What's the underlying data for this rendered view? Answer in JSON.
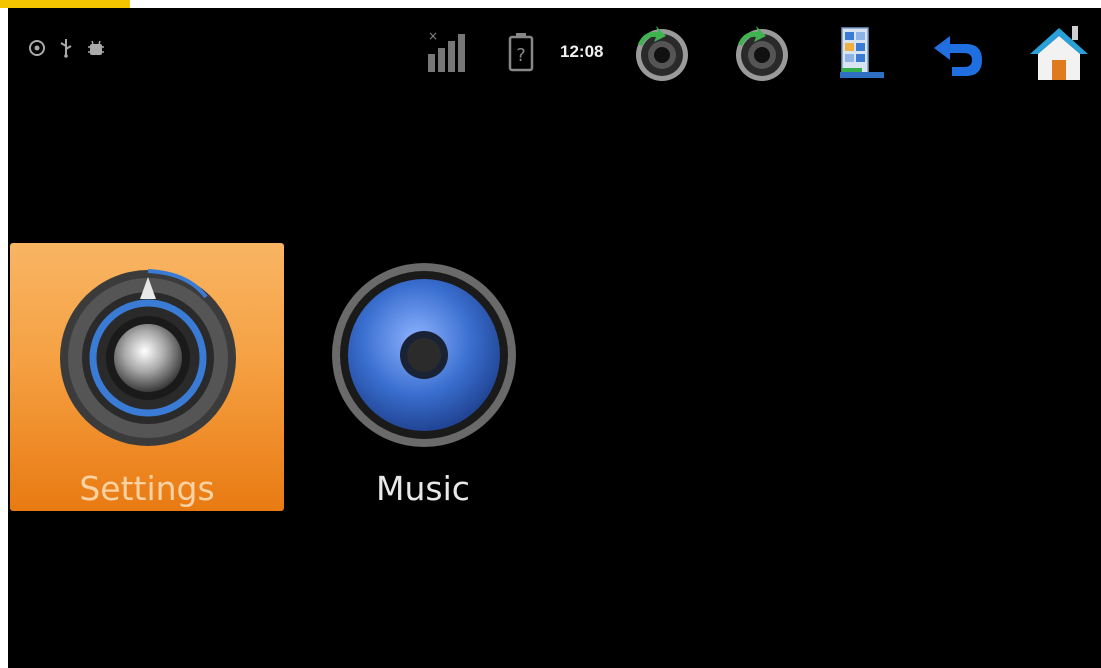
{
  "status_bar": {
    "time": "12:08",
    "left_icons": [
      "sync-icon",
      "usb-icon",
      "android-debug-icon"
    ],
    "signal_icon": "signal-bars-icon",
    "battery_icon": "battery-unknown-icon",
    "buttons": [
      {
        "name": "volume-down-button",
        "icon": "speaker-knob-arrow-icon"
      },
      {
        "name": "volume-up-button",
        "icon": "speaker-knob-arrow-icon"
      },
      {
        "name": "menu-button",
        "icon": "menu-panel-icon"
      },
      {
        "name": "back-button",
        "icon": "back-arrow-icon"
      },
      {
        "name": "home-button",
        "icon": "home-icon"
      }
    ]
  },
  "apps": [
    {
      "label": "Settings",
      "icon": "settings-knob-icon",
      "selected": true
    },
    {
      "label": "Music",
      "icon": "speaker-icon",
      "selected": false
    }
  ],
  "colors": {
    "background": "#000000",
    "selection": "#f5a042",
    "accent_blue": "#3a7bd5"
  }
}
